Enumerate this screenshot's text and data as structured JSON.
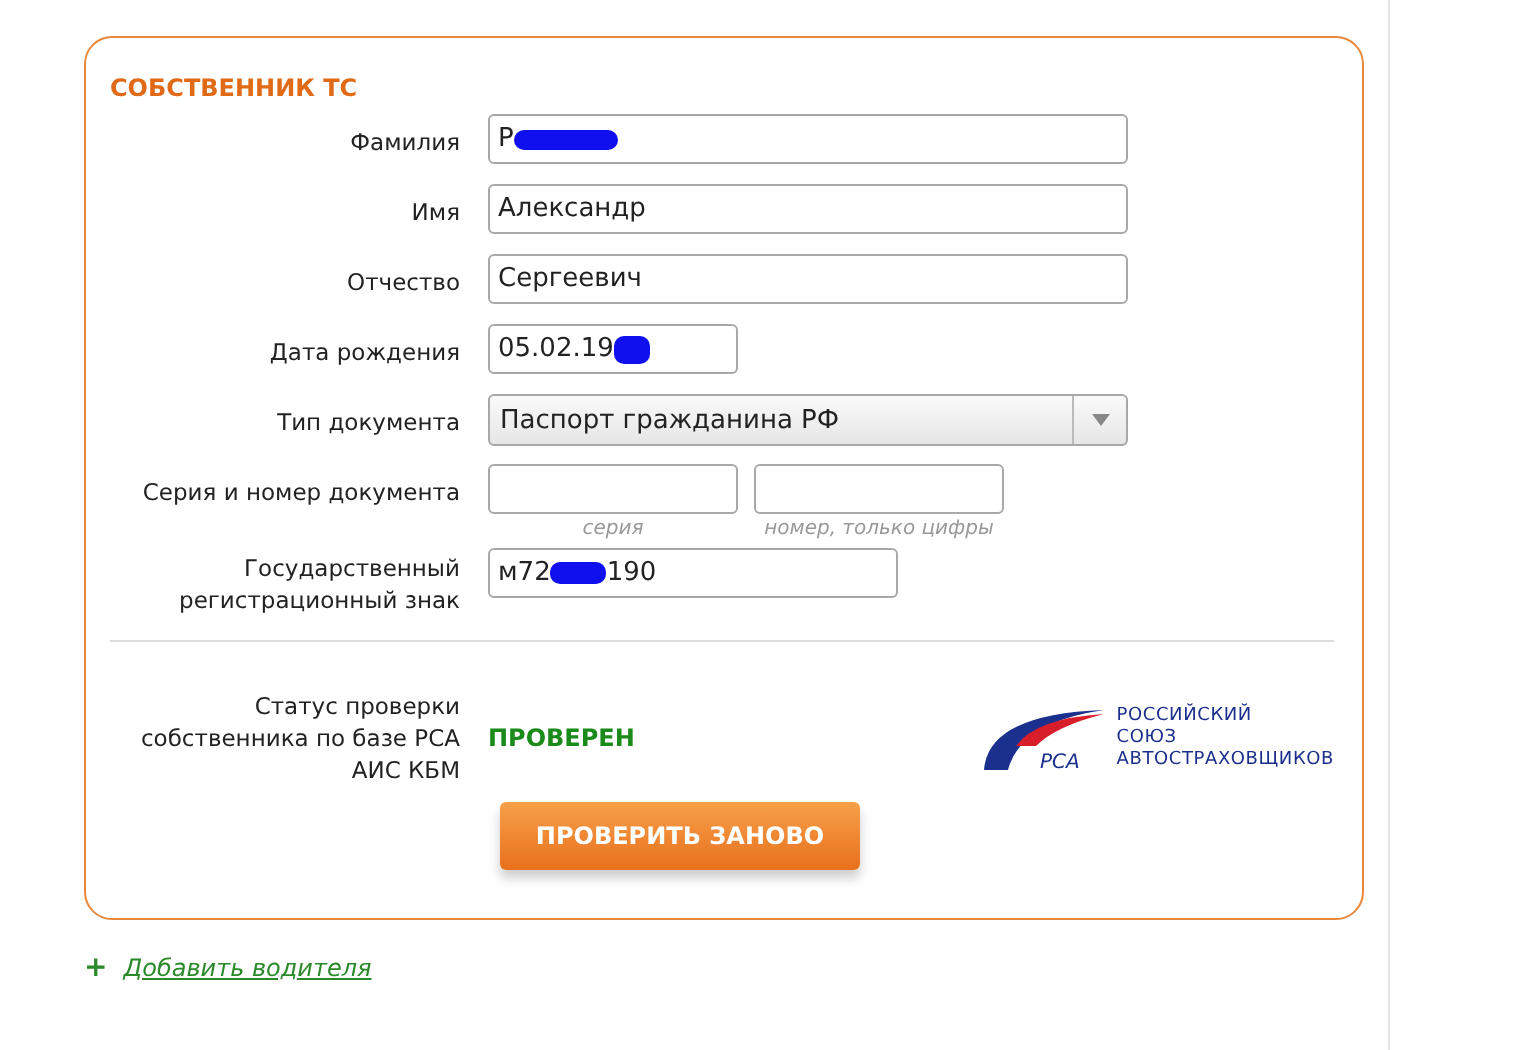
{
  "section": {
    "title": "СОБСТВЕННИК ТС"
  },
  "fields": [
    {
      "kind": "text",
      "label": "Фамилия",
      "value": "Р",
      "redacted": true
    },
    {
      "kind": "text",
      "label": "Имя",
      "value": "Александр",
      "redacted": false
    },
    {
      "kind": "text",
      "label": "Отчество",
      "value": "Сергеевич",
      "redacted": false
    },
    {
      "kind": "date",
      "label": "Дата рождения",
      "value": "05.02.19",
      "redacted": true
    },
    {
      "kind": "select",
      "label": "Тип документа",
      "value": "Паспорт гражданина РФ"
    },
    {
      "kind": "pair",
      "label": "Серия и номер документа",
      "hints": [
        "серия",
        "номер, только цифры"
      ]
    },
    {
      "kind": "plate",
      "label": "Государственный регистрационный знак",
      "value": "м72",
      "value_after": "190",
      "redacted": true
    }
  ],
  "status": {
    "label": "Статус проверки собственника по базе РСА АИС КБМ",
    "value": "ПРОВЕРЕН",
    "color": "#1a8a1a"
  },
  "logo": {
    "mark": "РСА",
    "lines": [
      "РОССИЙСКИЙ",
      "СОЮЗ",
      "АВТОСТРАХОВЩИКОВ"
    ]
  },
  "button": "ПРОВЕРИТЬ ЗАНОВО",
  "add_link": {
    "icon": "+",
    "label": "Добавить водителя"
  }
}
